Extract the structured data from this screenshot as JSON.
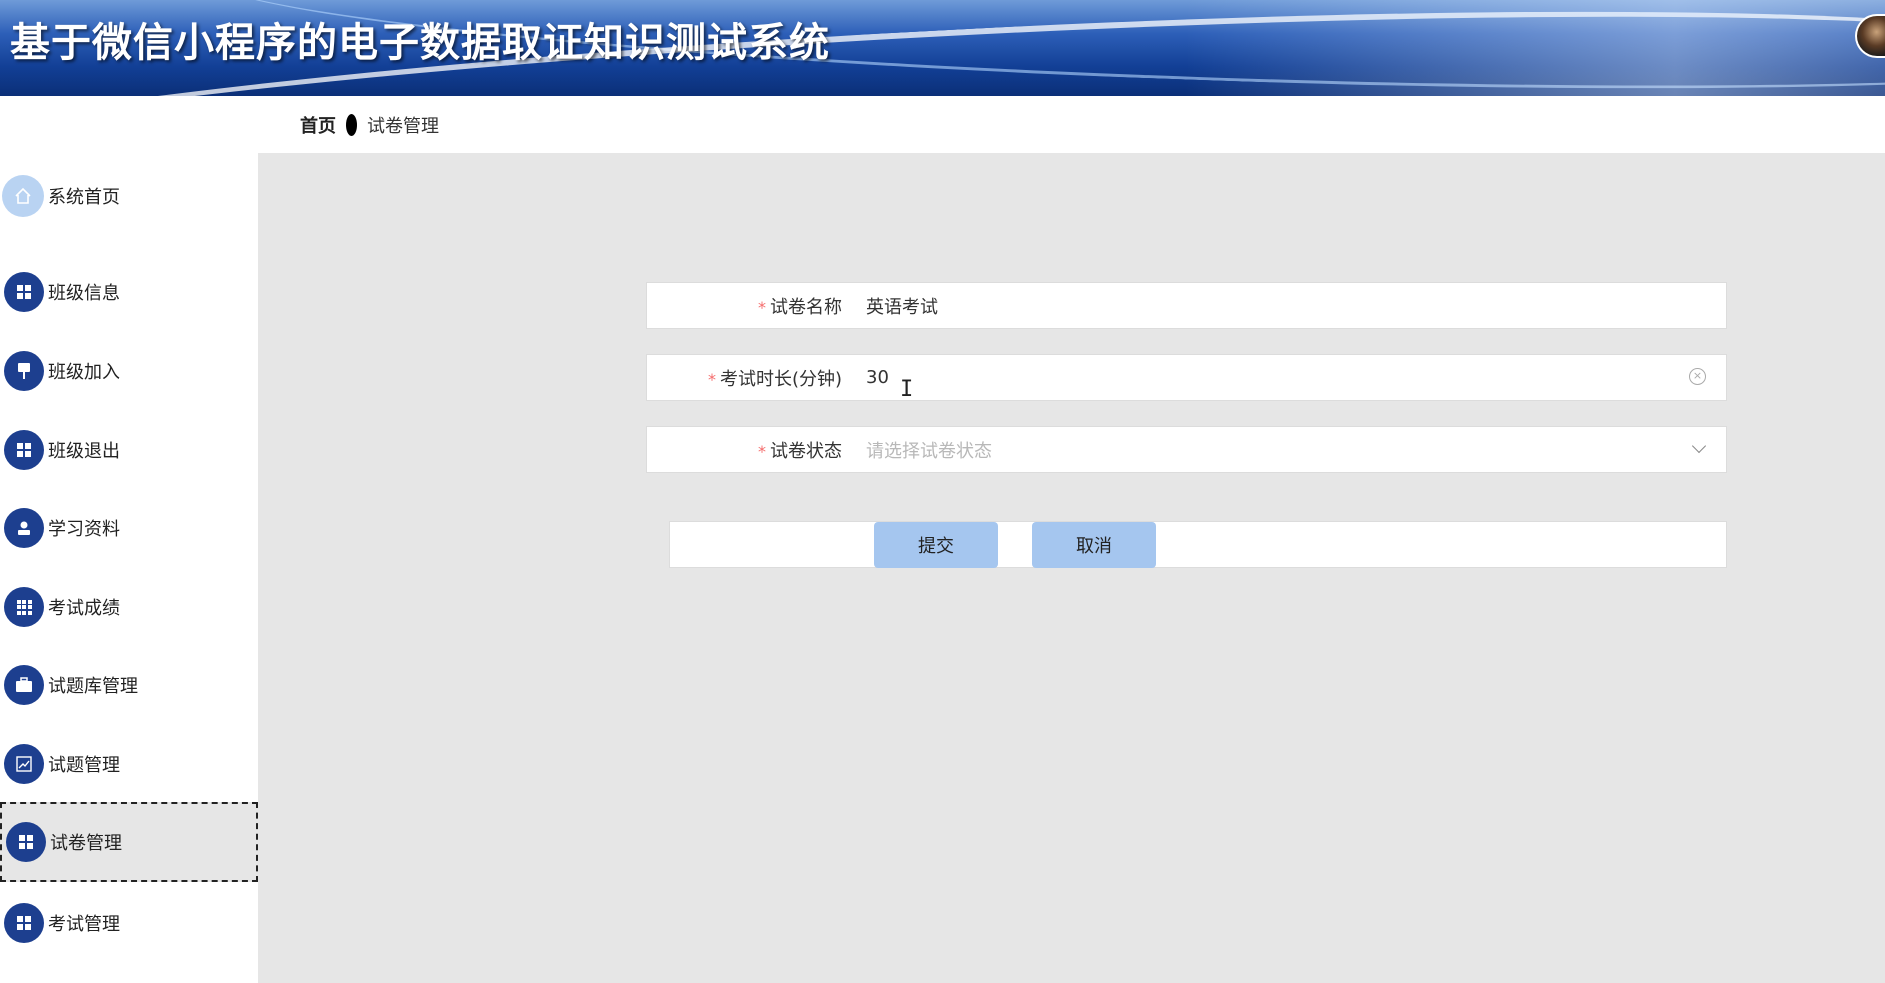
{
  "header": {
    "title": "基于微信小程序的电子数据取证知识测试系统"
  },
  "breadcrumb": {
    "home": "首页",
    "current": "试卷管理"
  },
  "sidebar": {
    "items": [
      {
        "label": "系统首页",
        "icon": "home-icon"
      },
      {
        "label": "班级信息",
        "icon": "grid-icon"
      },
      {
        "label": "班级加入",
        "icon": "flag-icon"
      },
      {
        "label": "班级退出",
        "icon": "grid-icon"
      },
      {
        "label": "学习资料",
        "icon": "person-icon"
      },
      {
        "label": "考试成绩",
        "icon": "table-icon"
      },
      {
        "label": "试题库管理",
        "icon": "briefcase-icon"
      },
      {
        "label": "试题管理",
        "icon": "chart-icon"
      },
      {
        "label": "试卷管理",
        "icon": "grid-icon",
        "active": true
      },
      {
        "label": "考试管理",
        "icon": "grid-icon"
      }
    ]
  },
  "form": {
    "paper_name": {
      "label": "试卷名称",
      "value": "英语考试",
      "required": true
    },
    "duration": {
      "label": "考试时长(分钟)",
      "value": "30",
      "required": true
    },
    "status": {
      "label": "试卷状态",
      "placeholder": "请选择试卷状态",
      "value": "",
      "required": true
    },
    "required_mark": "*",
    "submit_label": "提交",
    "cancel_label": "取消"
  },
  "colors": {
    "header_blue": "#123f95",
    "menu_icon_bg": "#1d3f8f",
    "button_bg": "#a5c6ef",
    "required": "#f56c6c"
  }
}
